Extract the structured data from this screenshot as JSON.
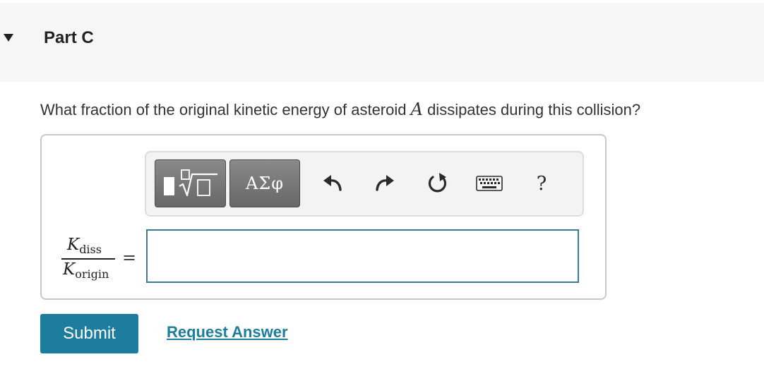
{
  "part": {
    "title": "Part C",
    "expanded": true
  },
  "question": {
    "text_before": "What fraction of the original kinetic energy of asteroid ",
    "variable": "A",
    "text_after": " dissipates during this collision?"
  },
  "toolbar": {
    "symbols_label": "ΑΣφ",
    "help_label": "?",
    "icons": [
      "templates-icon",
      "undo-icon",
      "redo-icon",
      "reset-icon",
      "keyboard-icon"
    ]
  },
  "answer": {
    "numerator_symbol": "K",
    "numerator_subscript": "diss",
    "denominator_symbol": "K",
    "denominator_subscript": "origin",
    "equals": "=",
    "value": ""
  },
  "actions": {
    "submit_label": "Submit",
    "request_answer_label": "Request Answer"
  },
  "colors": {
    "accent": "#1d7d9e",
    "input_border": "#3c7c93",
    "header_bg": "#f6f6f6"
  }
}
